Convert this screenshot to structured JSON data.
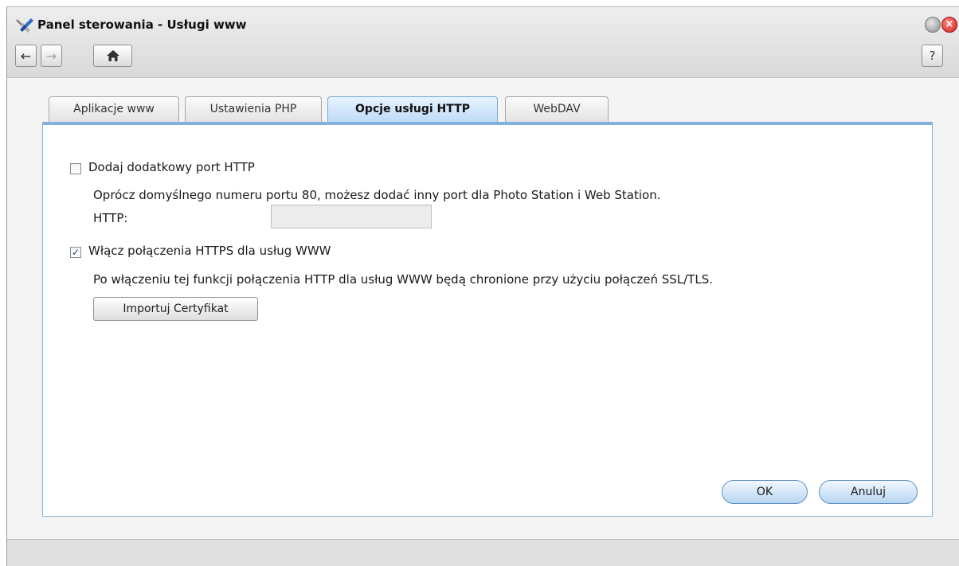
{
  "window": {
    "title": "Panel sterowania - Usługi www",
    "help_label": "?"
  },
  "tabs": [
    {
      "label": "Aplikacje www",
      "active": false
    },
    {
      "label": "Ustawienia PHP",
      "active": false
    },
    {
      "label": "Opcje usługi HTTP",
      "active": true
    },
    {
      "label": "WebDAV",
      "active": false
    }
  ],
  "http_port": {
    "checkbox_label": "Dodaj dodatkowy port HTTP",
    "checked": false,
    "description": "Oprócz domyślnego numeru portu 80, możesz dodać inny port dla Photo Station i Web Station.",
    "field_label": "HTTP:",
    "field_value": ""
  },
  "https": {
    "checkbox_label": "Włącz połączenia HTTPS dla usług WWW",
    "checked": true,
    "description": "Po włączeniu tej funkcji połączenia HTTP dla usług WWW będą chronione przy użyciu połączeń SSL/TLS.",
    "import_button": "Importuj Certyfikat"
  },
  "footer": {
    "ok_label": "OK",
    "cancel_label": "Anuluj"
  },
  "icons": {
    "app": "control-panel-icon",
    "back": "arrow-left-icon",
    "forward": "arrow-right-icon",
    "home": "home-icon",
    "minimize": "minimize-icon",
    "close": "close-icon"
  },
  "colors": {
    "accent": "#7fb0de",
    "active_tab": "#bcdaf7",
    "close_button": "#cc1f1f"
  }
}
